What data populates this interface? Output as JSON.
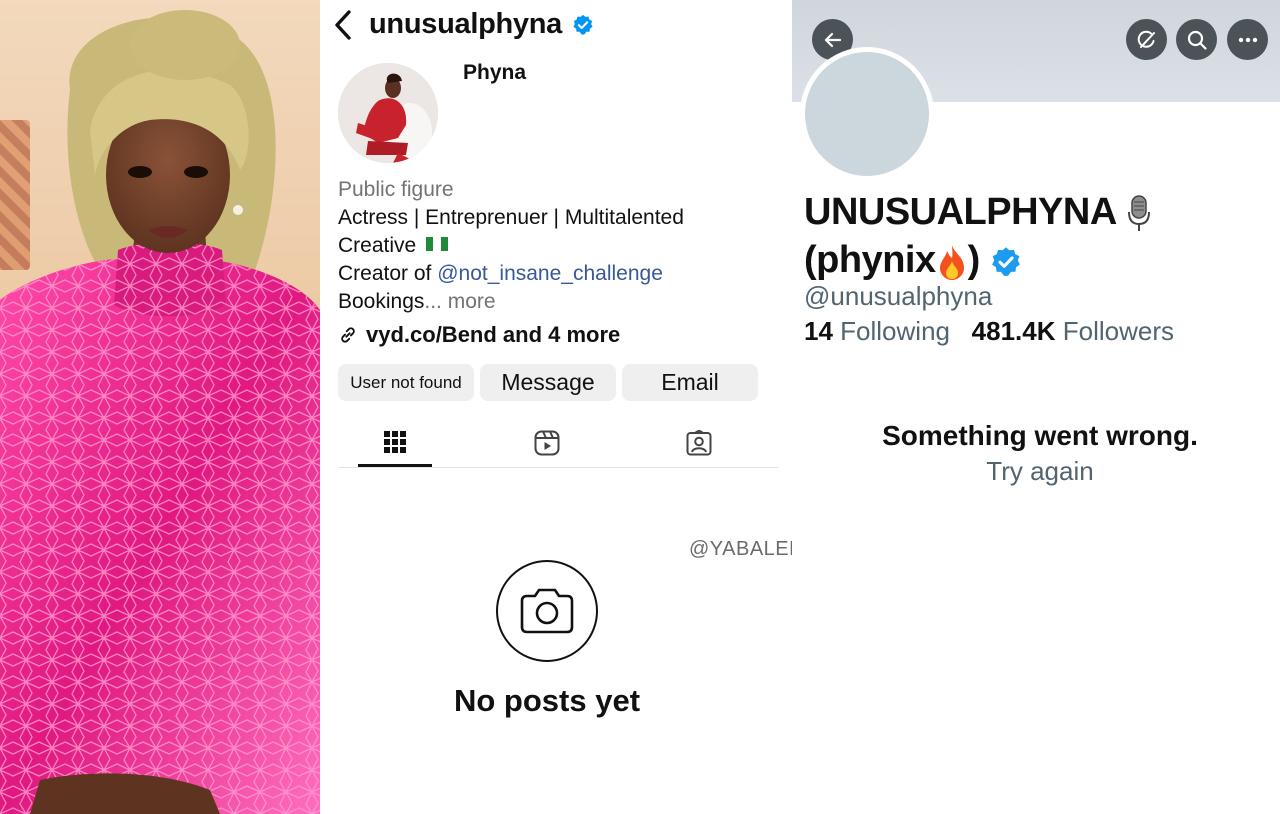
{
  "instagram": {
    "username": "unusualphyna",
    "display_name": "Phyna",
    "category": "Public figure",
    "bio_line1": "Actress | Entreprenuer | Multitalented",
    "bio_line2": "Creative",
    "bio_line3_prefix": "Creator of ",
    "bio_mention": "@not_insane_challenge",
    "bio_line4": "Bookings",
    "more_label": "... more",
    "link_text": "vyd.co/Bend and 4 more",
    "buttons": {
      "user_not_found": "User not found",
      "message": "Message",
      "email": "Email"
    },
    "tabs": [
      "grid-icon",
      "reels-icon",
      "tagged-icon"
    ],
    "empty_state": "No posts yet",
    "accent_mention": "#385898",
    "verified_color": "#0095f6"
  },
  "watermark": "@YABALEFTONLINE",
  "twitter": {
    "name_line1": "UNUSUALPHYNA",
    "name_line2": "(phynix",
    "name_line2_close": ")",
    "handle": "@unusualphyna",
    "following_count": "14",
    "following_label": "Following",
    "followers_count": "481.4K",
    "followers_label": "Followers",
    "error_title": "Something went wrong.",
    "retry_label": "Try again",
    "verified_color": "#1d9bf0"
  }
}
